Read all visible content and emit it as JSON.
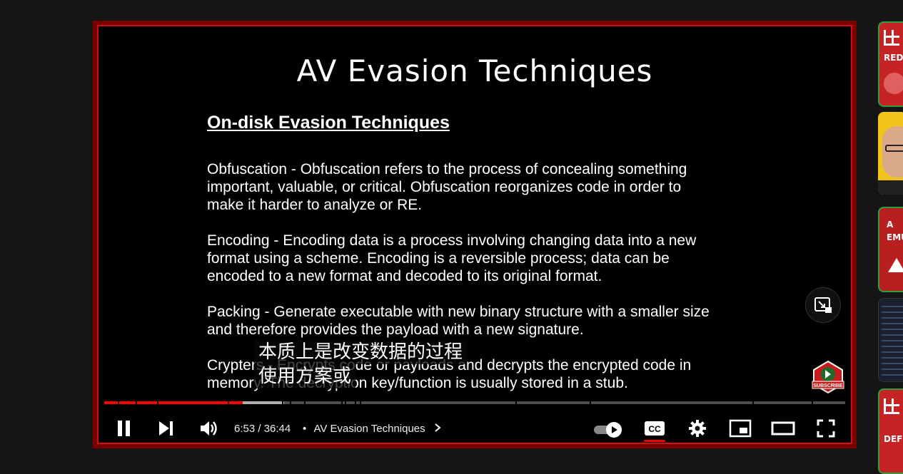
{
  "slide": {
    "title": "AV Evasion Techniques",
    "heading": "On-disk Evasion Techniques",
    "paragraphs": [
      "Obfuscation - Obfuscation refers to the process of concealing something\nimportant, valuable, or critical. Obfuscation reorganizes code in order to\nmake it harder to analyze or RE.",
      "Encoding - Encoding data is a process involving changing data into a new\nformat using a scheme. Encoding is a reversible process; data can be\nencoded to a new format and decoded to its original format.",
      "Packing - Generate executable with new binary structure with a smaller size\nand therefore provides the payload with a new signature.",
      "Crypters - Encrypts code or payloads and decrypts the encrypted code in\nmemory. The decryption key/function is usually stored in a stub."
    ]
  },
  "subtitles": [
    "本质上是改变数据的过程",
    "使用方案或"
  ],
  "player": {
    "time": "6:53 / 36:44",
    "separator": "•",
    "chapter": "AV Evasion Techniques",
    "progress_played_fraction": 0.187,
    "progress_buffered_fraction": 0.243,
    "subscribe_label": "SUBSCRIBE"
  },
  "sidebar_thumbs": [
    {
      "text": "RED T",
      "border": "#2e9e3e"
    },
    {
      "text": "",
      "border": "#222"
    },
    {
      "text": "A\nEMU",
      "border": "#2e9e3e"
    },
    {
      "text": "",
      "border": "#333"
    },
    {
      "text": "DEFE",
      "border": "#2e9e3e"
    }
  ],
  "colors": {
    "accent": "#ff0000",
    "frame": "#7a0000"
  }
}
